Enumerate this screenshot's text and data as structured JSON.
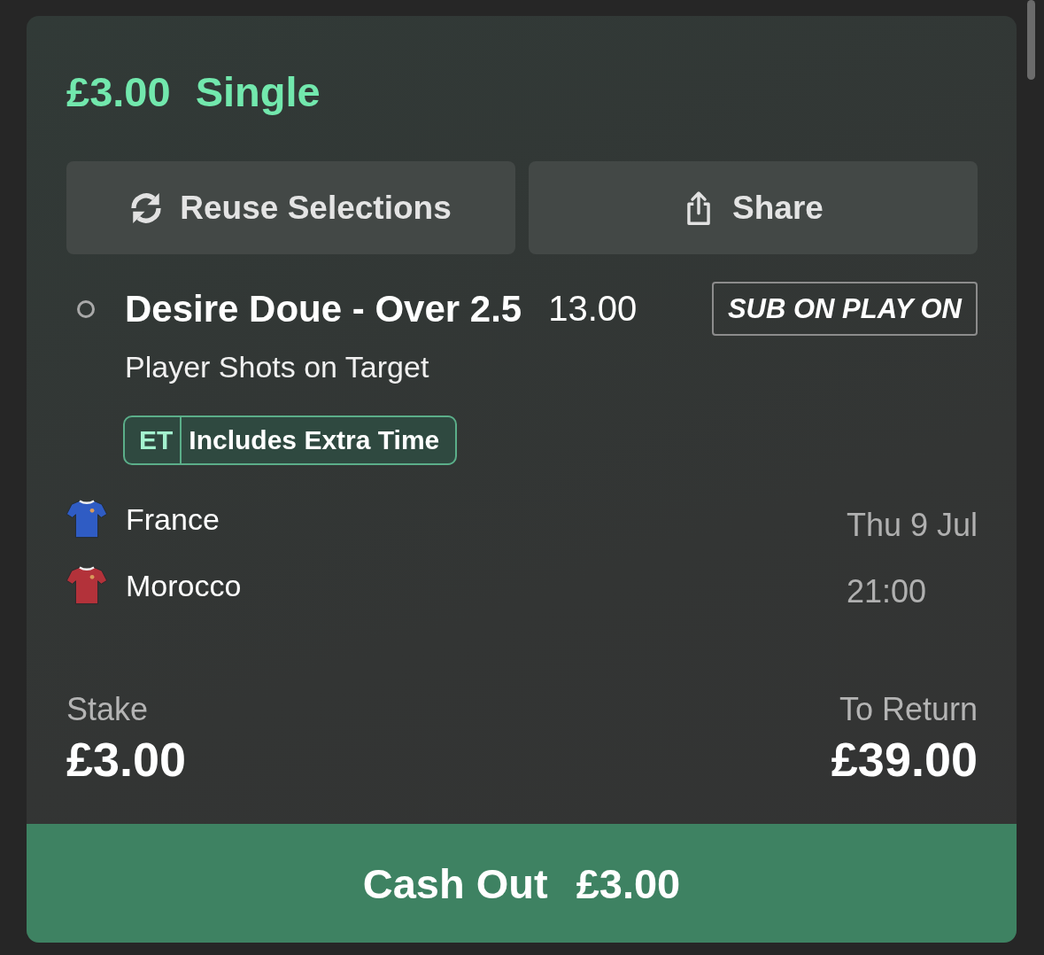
{
  "bet": {
    "stake_amount": "£3.00",
    "bet_type": "Single"
  },
  "actions": [
    {
      "kind": "reuse",
      "label": "Reuse Selections"
    },
    {
      "kind": "share",
      "label": "Share"
    }
  ],
  "selection": {
    "settled": false,
    "name": "Desire Doue - Over 2.5",
    "odds": "13.00",
    "promo_badge": "SUB ON PLAY ON",
    "market": "Player Shots on Target",
    "tag": {
      "code": "ET",
      "label": "Includes Extra Time"
    }
  },
  "match": {
    "teams": [
      {
        "name": "France",
        "color": "#2f5cc4"
      },
      {
        "name": "Morocco",
        "color": "#b3323a"
      }
    ],
    "date": "Thu 9 Jul",
    "time": "21:00"
  },
  "summary": {
    "stake_label": "Stake",
    "stake": "£3.00",
    "return_label": "To Return",
    "return": "£39.00"
  },
  "cash_out": {
    "label": "Cash Out",
    "amount": "£3.00"
  }
}
